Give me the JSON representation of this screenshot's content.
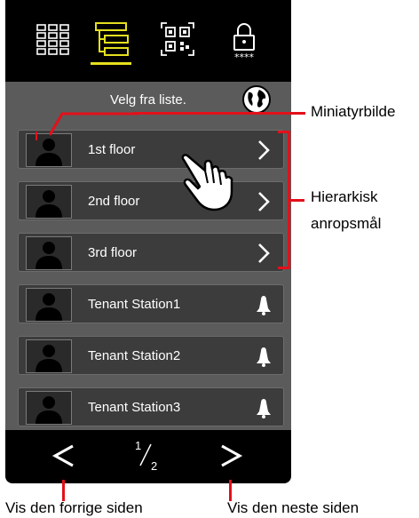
{
  "header": {
    "title": "Velg fra liste."
  },
  "toolbar": {
    "tools": [
      {
        "icon": "grid-keypad-icon",
        "active": false
      },
      {
        "icon": "hierarchy-list-icon",
        "active": true
      },
      {
        "icon": "qr-code-icon",
        "active": false
      },
      {
        "icon": "lock-passcode-icon",
        "active": false
      }
    ],
    "active_color": "#e5e01f"
  },
  "rows": [
    {
      "label": "1st floor",
      "icon": "chevron-right-icon"
    },
    {
      "label": "2nd floor",
      "icon": "chevron-right-icon"
    },
    {
      "label": "3rd floor",
      "icon": "chevron-right-icon"
    },
    {
      "label": "Tenant Station1",
      "icon": "bell-icon"
    },
    {
      "label": "Tenant Station2",
      "icon": "bell-icon"
    },
    {
      "label": "Tenant Station3",
      "icon": "bell-icon"
    }
  ],
  "pager": {
    "current": "1",
    "total": "2"
  },
  "callouts": {
    "thumbnail": "Miniatyrbilde",
    "hierarchy_line1": "Hierarkisk",
    "hierarchy_line2": "anropsmål",
    "prev_page": "Vis den forrige siden",
    "next_page": "Vis den neste siden"
  },
  "colors": {
    "callout": "#e3101a",
    "screen": "#000000",
    "panel": "#5b5b5b"
  }
}
